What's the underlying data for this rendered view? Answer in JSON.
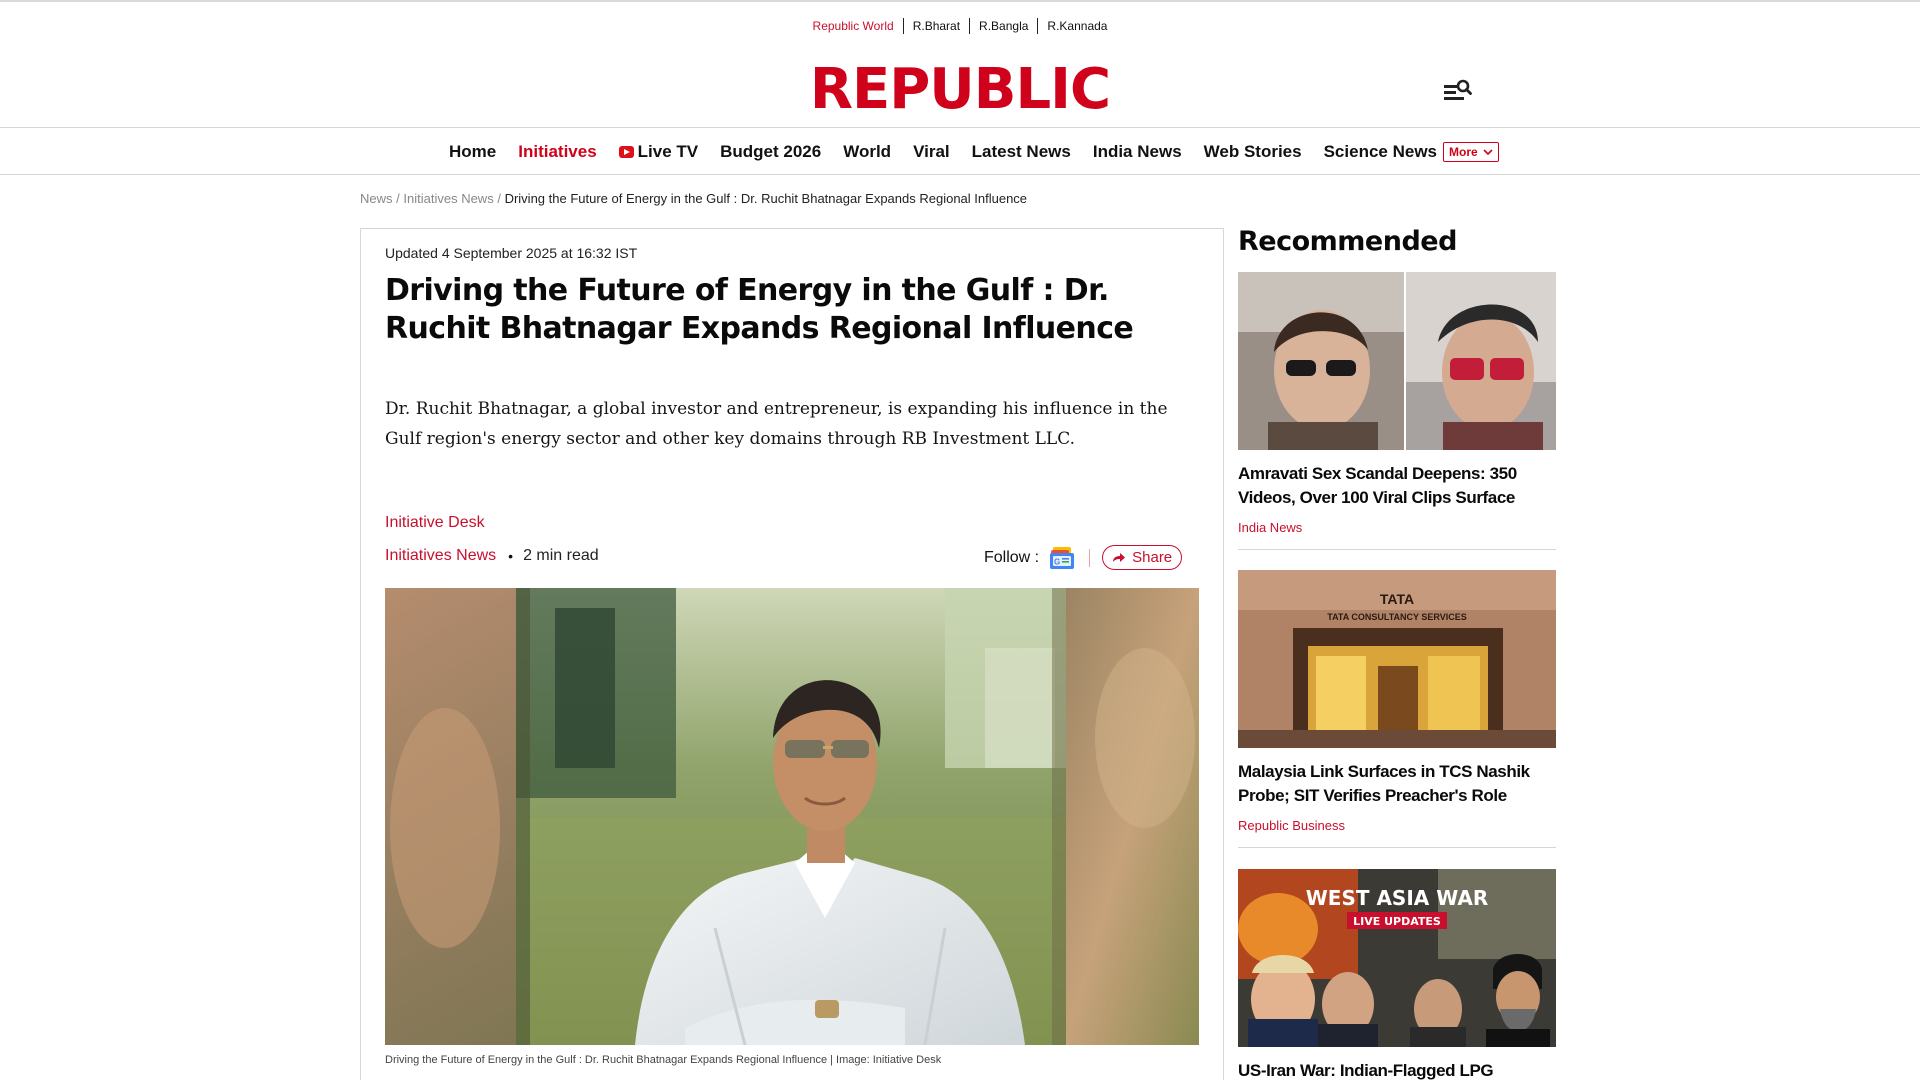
{
  "network": {
    "links": [
      "Republic World",
      "R.Bharat",
      "R.Bangla",
      "R.Kannada"
    ]
  },
  "logo": "REPUBLIC",
  "nav": {
    "items": [
      "Home",
      "Initiatives",
      "Live TV",
      "Budget 2026",
      "World",
      "Viral",
      "Latest News",
      "India News",
      "Web Stories",
      "Science News"
    ],
    "more_label": "More"
  },
  "breadcrumb": {
    "items": [
      "News",
      "Initiatives News"
    ],
    "separator": "/",
    "current": "Driving the Future of Energy in the Gulf : Dr. Ruchit Bhatnagar Expands Regional Influence"
  },
  "article": {
    "updated": "Updated 4 September 2025 at 16:32 IST",
    "headline": "Driving the Future of Energy in the Gulf : Dr. Ruchit Bhatnagar Expands Regional Influence",
    "summary": "Dr. Ruchit Bhatnagar, a global investor and entrepreneur, is expanding his influence in the Gulf region's energy sector and other key domains through RB Investment LLC.",
    "author": "Initiative Desk",
    "category": "Initiatives News",
    "dot": "•",
    "read_time": "2 min read",
    "follow_label": "Follow :",
    "share_label": "Share",
    "caption": "Driving the Future of Energy in the Gulf : Dr. Ruchit Bhatnagar Expands Regional Influence | Image: Initiative Desk"
  },
  "sidebar": {
    "heading": "Recommended",
    "cards": [
      {
        "title": "Amravati Sex Scandal Deepens: 350 Videos, Over 100 Viral Clips Surface",
        "category": "India News"
      },
      {
        "title": "Malaysia Link Surfaces in TCS Nashik Probe; SIT Verifies Preacher's Role",
        "category": "Republic Business",
        "thumb_sign_top": "TATA",
        "thumb_sign_bottom": "TATA CONSULTANCY SERVICES"
      },
      {
        "title": "US-Iran War: Indian-Flagged LPG",
        "thumb_banner": "WEST ASIA WAR",
        "thumb_badge": "LIVE UPDATES"
      }
    ]
  },
  "colors": {
    "brand_red": "#d0021b",
    "link_red": "#c8102e"
  }
}
